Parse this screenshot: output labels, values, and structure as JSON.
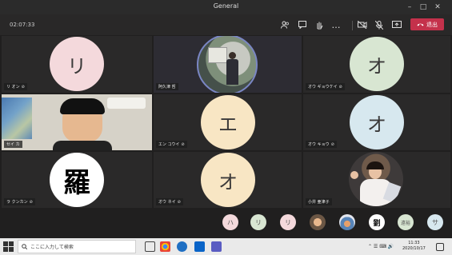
{
  "window": {
    "title": "General"
  },
  "meeting": {
    "timer": "02:07:33",
    "leave_label": "退出"
  },
  "tiles": [
    {
      "name": "リ オン",
      "avatar_text": "リ",
      "avatar_color": "#f4d9dc"
    },
    {
      "name": "阿久津 哲",
      "avatar_text": "",
      "avatar_color": ""
    },
    {
      "name": "オウ ギョウケイ",
      "avatar_text": "オ",
      "avatar_color": "#d8e6d2"
    },
    {
      "name": "セイ カ",
      "avatar_text": "",
      "avatar_color": ""
    },
    {
      "name": "エン コウイ",
      "avatar_text": "エ",
      "avatar_color": "#f8e6c4"
    },
    {
      "name": "オウ キョウ",
      "avatar_text": "オ",
      "avatar_color": "#d7e8ef"
    },
    {
      "name": "ラ クンカン",
      "avatar_text": "",
      "avatar_color": ""
    },
    {
      "name": "オウ ネイ",
      "avatar_text": "オ",
      "avatar_color": "#f8e6c4"
    },
    {
      "name": "小井 亜津子",
      "avatar_text": "",
      "avatar_color": ""
    }
  ],
  "participants": [
    {
      "text": "ハ",
      "color": "#f4d9dc"
    },
    {
      "text": "リ",
      "color": "#d8e6d2"
    },
    {
      "text": "リ",
      "color": "#f4d9dc"
    },
    {
      "text": "",
      "color": "#c9a88a"
    },
    {
      "text": "",
      "color": "#a3b9d6"
    },
    {
      "text": "劉",
      "color": "#ffffff"
    },
    {
      "text": "遠裕",
      "color": "#d8e6d2"
    },
    {
      "text": "サ",
      "color": "#d7e8ef"
    }
  ],
  "taskbar": {
    "search_placeholder": "ここに入力して検索",
    "time": "11:33",
    "date": "2020/10/17"
  }
}
